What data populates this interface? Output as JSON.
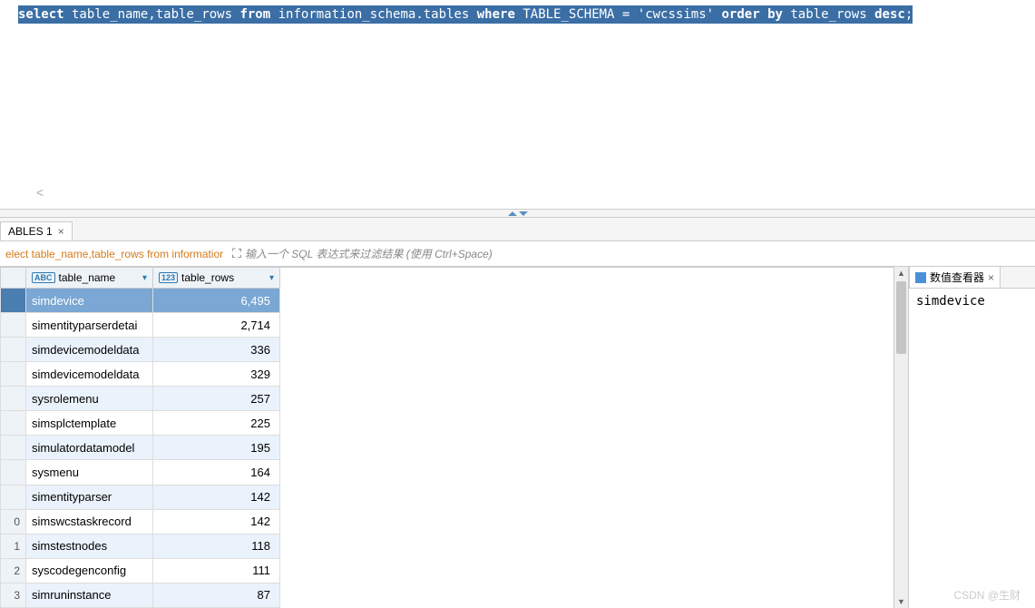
{
  "sql": {
    "tokens": [
      {
        "t": "select",
        "kw": true
      },
      {
        "t": " table_name,table_rows "
      },
      {
        "t": "from",
        "kw": true
      },
      {
        "t": " information_schema.tables "
      },
      {
        "t": "where",
        "kw": true
      },
      {
        "t": " TABLE_SCHEMA = "
      },
      {
        "t": "'cwcssims'",
        "str": true
      },
      {
        "t": " "
      },
      {
        "t": "order by",
        "kw": true
      },
      {
        "t": " table_rows "
      },
      {
        "t": "desc",
        "kw": true
      },
      {
        "t": ";"
      }
    ],
    "scroll_hint": "<"
  },
  "results_tab": {
    "label": "ABLES 1",
    "close": "×"
  },
  "filter": {
    "query_preview": "elect table_name,table_rows from informatior",
    "expand_icon": "⛶",
    "placeholder": "输入一个 SQL 表达式来过滤结果 (使用 Ctrl+Space)"
  },
  "columns": {
    "name": {
      "label": "table_name",
      "type_badge": "ABC"
    },
    "rows": {
      "label": "table_rows",
      "type_badge": "123"
    }
  },
  "rows": [
    {
      "n": "",
      "name": "simdevice",
      "rows": "6,495",
      "selected": true
    },
    {
      "n": "",
      "name": "simentityparserdetai",
      "rows": "2,714"
    },
    {
      "n": "",
      "name": "simdevicemodeldata",
      "rows": "336",
      "alt": true
    },
    {
      "n": "",
      "name": "simdevicemodeldata",
      "rows": "329"
    },
    {
      "n": "",
      "name": "sysrolemenu",
      "rows": "257",
      "alt": true
    },
    {
      "n": "",
      "name": "simsplctemplate",
      "rows": "225"
    },
    {
      "n": "",
      "name": "simulatordatamodel",
      "rows": "195",
      "alt": true
    },
    {
      "n": "",
      "name": "sysmenu",
      "rows": "164"
    },
    {
      "n": "",
      "name": "simentityparser",
      "rows": "142",
      "alt": true
    },
    {
      "n": "0",
      "name": "simswcstaskrecord",
      "rows": "142"
    },
    {
      "n": "1",
      "name": "simstestnodes",
      "rows": "118",
      "alt": true
    },
    {
      "n": "2",
      "name": "syscodegenconfig",
      "rows": "111"
    },
    {
      "n": "3",
      "name": "simruninstance",
      "rows": "87",
      "alt": true
    }
  ],
  "value_viewer": {
    "tab_label": "数值查看器",
    "close": "×",
    "content": "simdevice"
  },
  "watermark": "CSDN @生财"
}
